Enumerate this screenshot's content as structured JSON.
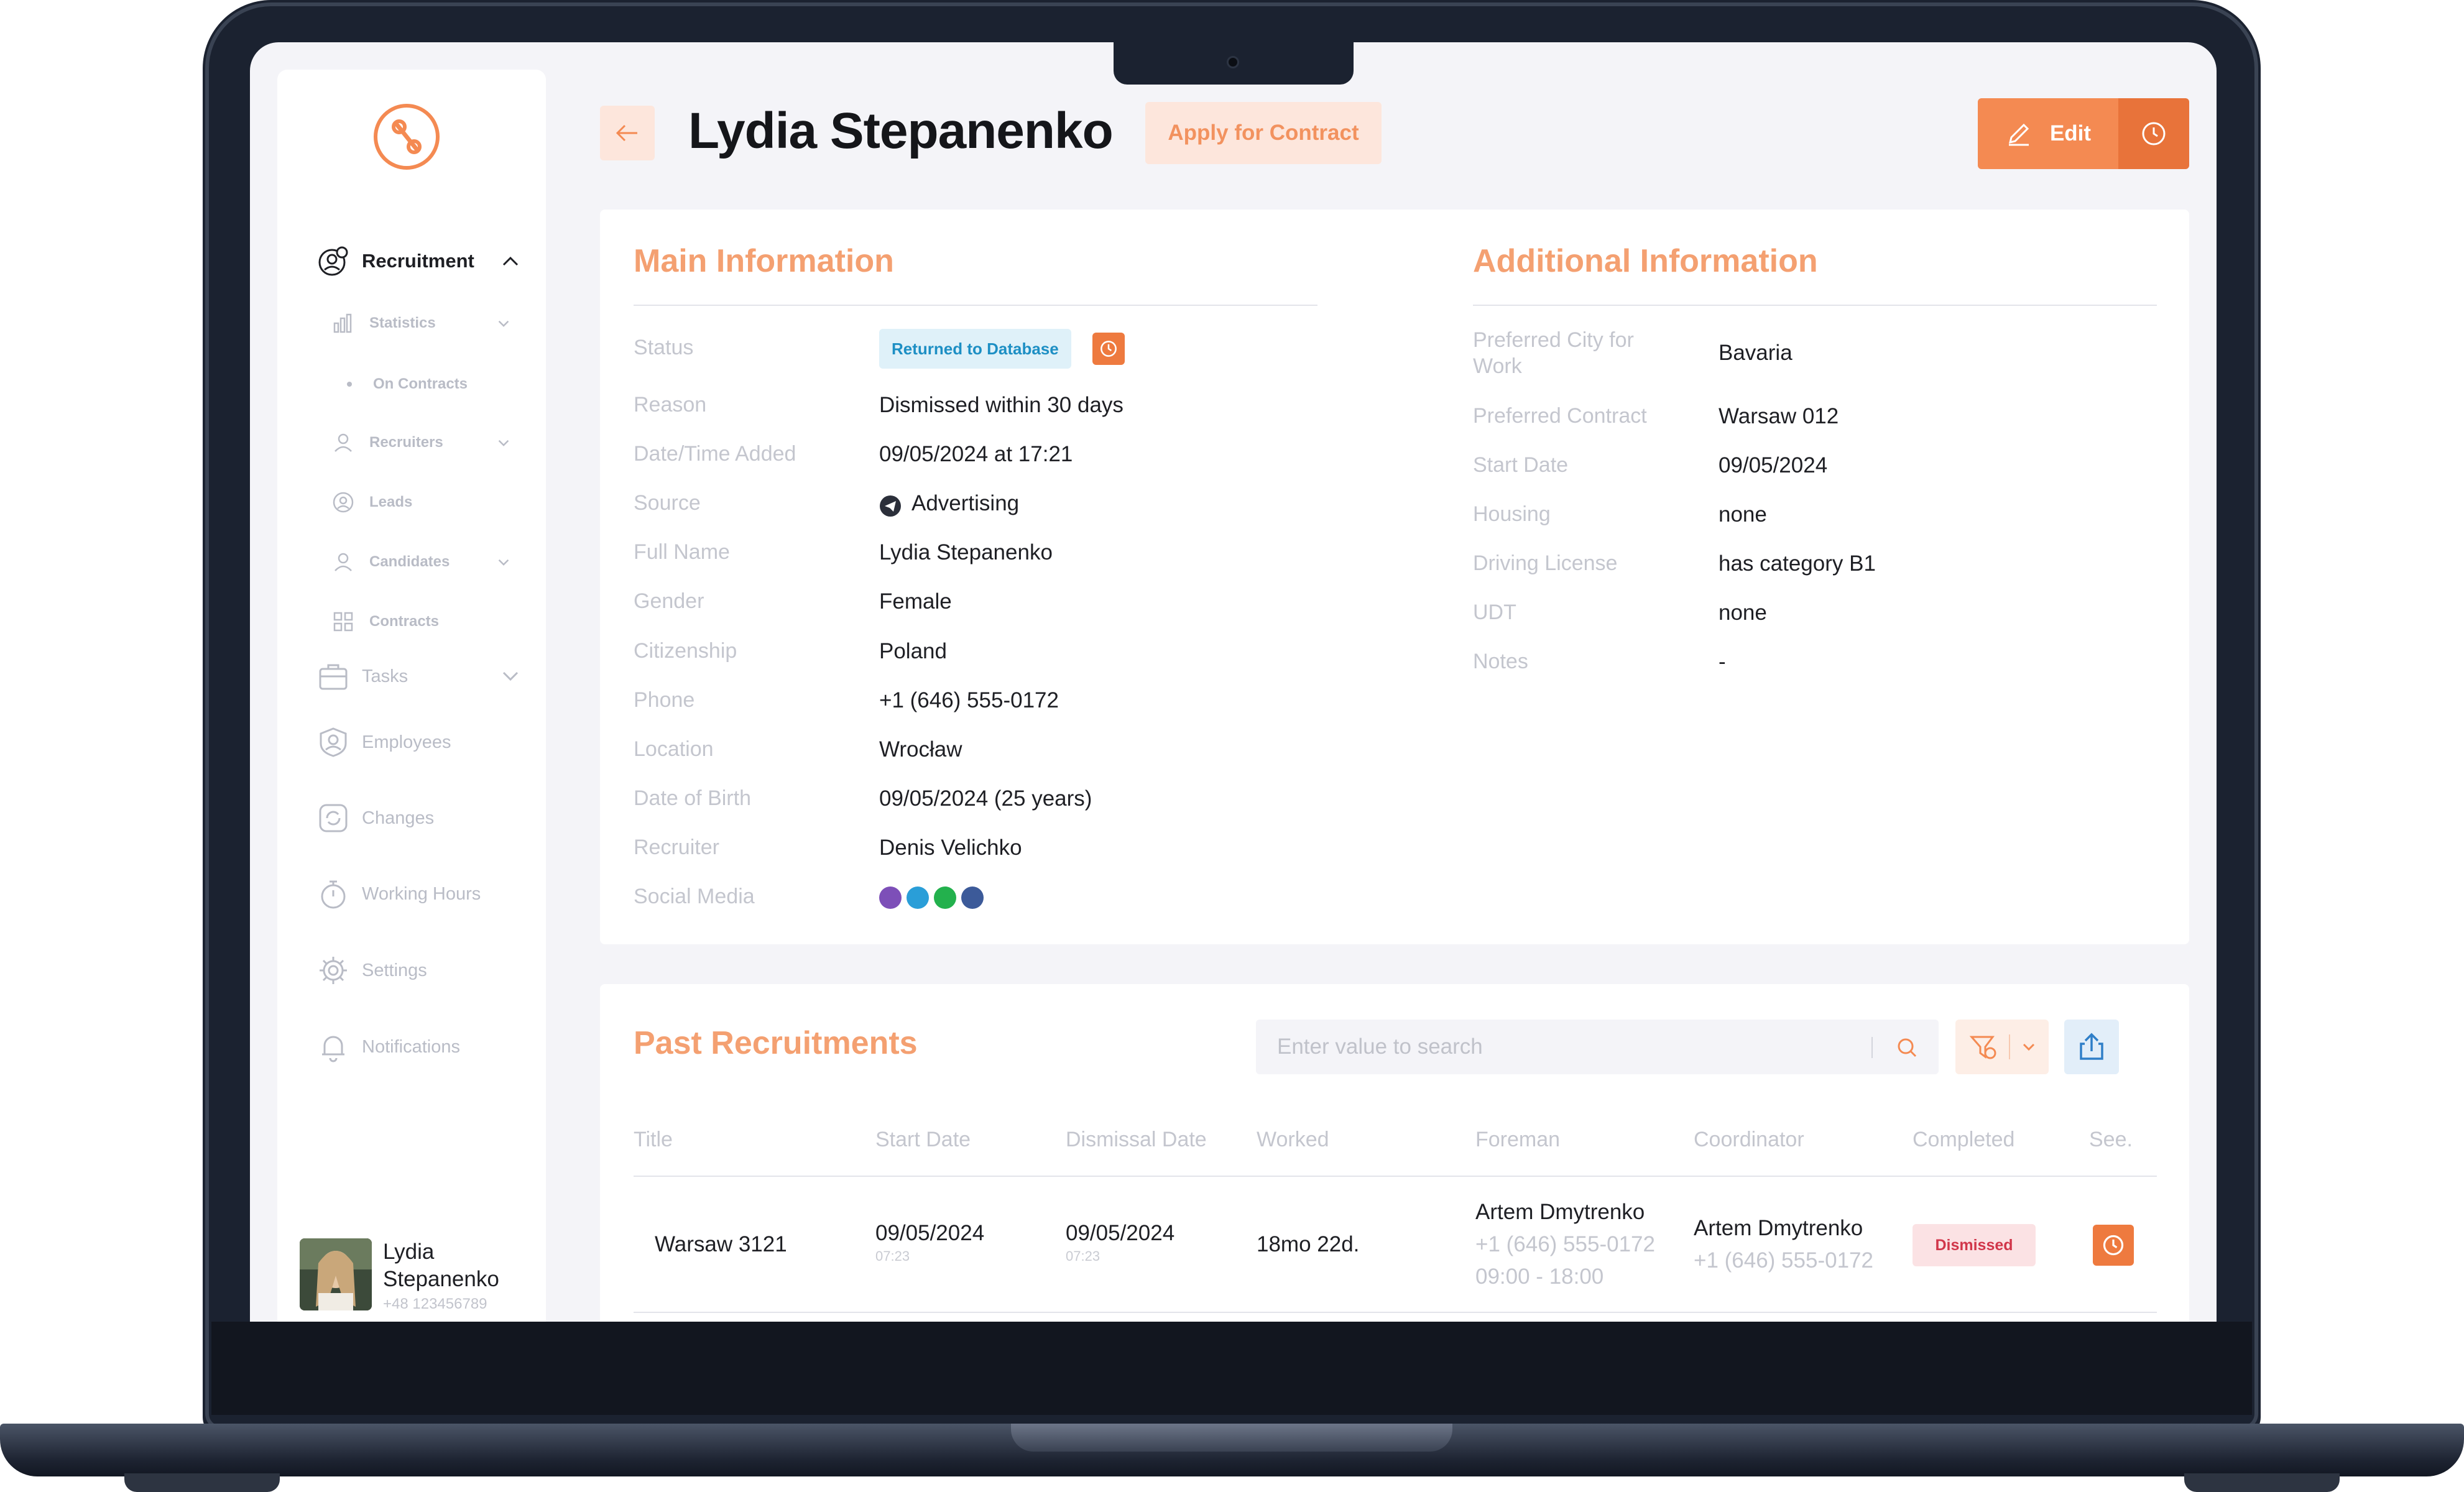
{
  "sidebar": {
    "items": [
      {
        "label": "Recruitment",
        "icon": "recruitment-icon"
      },
      {
        "label": "Statistics",
        "icon": "chart-icon"
      },
      {
        "label": "On Contracts",
        "icon": "dot-icon"
      },
      {
        "label": "Recruiters",
        "icon": "user-icon"
      },
      {
        "label": "Leads",
        "icon": "user-circle-icon"
      },
      {
        "label": "Candidates",
        "icon": "user-icon"
      },
      {
        "label": "Contracts",
        "icon": "grid-icon"
      },
      {
        "label": "Tasks",
        "icon": "briefcase-icon"
      },
      {
        "label": "Employees",
        "icon": "employee-icon"
      },
      {
        "label": "Changes",
        "icon": "refresh-icon"
      },
      {
        "label": "Working Hours",
        "icon": "stopwatch-icon"
      },
      {
        "label": "Settings",
        "icon": "gear-icon"
      },
      {
        "label": "Notifications",
        "icon": "bell-icon"
      }
    ],
    "profile": {
      "first": "Lydia",
      "last": "Stepanenko",
      "phone": "+48 123456789"
    }
  },
  "header": {
    "title": "Lydia Stepanenko",
    "apply_label": "Apply for Contract",
    "edit_label": "Edit"
  },
  "main_info": {
    "title": "Main Information",
    "status_label": "Status",
    "status_value": "Returned to Database",
    "rows": [
      {
        "label": "Reason",
        "value": "Dismissed within 30 days"
      },
      {
        "label": "Date/Time Added",
        "value": "09/05/2024 at 17:21"
      },
      {
        "label": "Source",
        "value": "Advertising"
      },
      {
        "label": "Full Name",
        "value": "Lydia Stepanenko"
      },
      {
        "label": "Gender",
        "value": "Female"
      },
      {
        "label": "Citizenship",
        "value": "Poland"
      },
      {
        "label": "Phone",
        "value": "+1 (646) 555-0172"
      },
      {
        "label": "Location",
        "value": "Wrocław"
      },
      {
        "label": "Date of Birth",
        "value": "09/05/2024 (25 years)"
      },
      {
        "label": "Recruiter",
        "value": "Denis Velichko"
      }
    ],
    "social_label": "Social Media",
    "social": [
      "viber",
      "telegram",
      "whatsapp",
      "facebook"
    ]
  },
  "additional_info": {
    "title": "Additional Information",
    "rows": [
      {
        "label": "Preferred City for Work",
        "value": "Bavaria"
      },
      {
        "label": "Preferred Contract",
        "value": "Warsaw 012"
      },
      {
        "label": "Start Date",
        "value": "09/05/2024"
      },
      {
        "label": "Housing",
        "value": "none"
      },
      {
        "label": "Driving License",
        "value": "has category B1"
      },
      {
        "label": "UDT",
        "value": "none"
      },
      {
        "label": "Notes",
        "value": "-"
      }
    ]
  },
  "past": {
    "title": "Past Recruitments",
    "search_placeholder": "Enter value to search",
    "columns": [
      "Title",
      "Start Date",
      "Dismissal Date",
      "Worked",
      "Foreman",
      "Coordinator",
      "Completed",
      "See."
    ],
    "rows": [
      {
        "title": "Warsaw 3121",
        "start_date": "09/05/2024",
        "start_time": "07:23",
        "dismissal_date": "09/05/2024",
        "dismissal_time": "07:23",
        "worked": "18mo 22d.",
        "foreman_name": "Artem Dmytrenko",
        "foreman_phone": "+1 (646) 555-0172",
        "foreman_hours": "09:00 - 18:00",
        "coordinator_name": "Artem Dmytrenko",
        "coordinator_phone": "+1 (646) 555-0172",
        "completed": "Dismissed"
      }
    ]
  },
  "colors": {
    "accent": "#f48a52",
    "accent_dark": "#e8733a",
    "title_orange": "#f4a071",
    "status_blue": "#1d8fc4",
    "danger": "#d1364a"
  }
}
